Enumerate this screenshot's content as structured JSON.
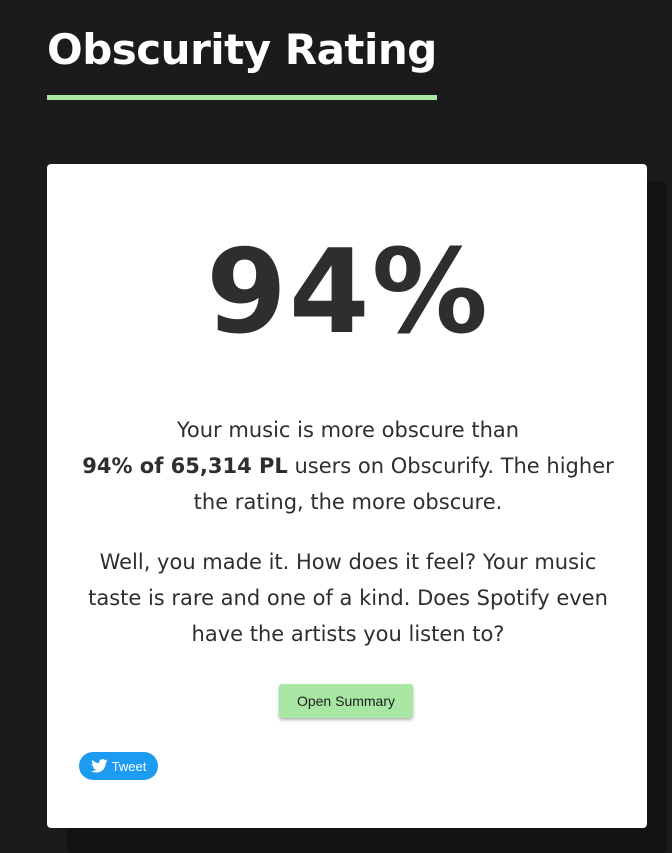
{
  "header": {
    "title": "Obscurity Rating"
  },
  "card": {
    "rating": "94%",
    "summary": {
      "lead": "Your music is more obscure than",
      "bold": "94% of 65,314 PL",
      "rest": " users on Obscurify. The higher the rating, the more obscure."
    },
    "message": "Well, you made it. How does it feel? Your music taste is rare and one of a kind. Does Spotify even have the artists you listen to?",
    "summary_button_label": "Open Summary",
    "tweet_button_label": "Tweet",
    "tweet_icon": "twitter-bird-icon"
  },
  "colors": {
    "background": "#1b1b1b",
    "accent": "#a8e6a3",
    "card": "#ffffff",
    "text": "#2e2e2e",
    "twitter": "#1d9bf0"
  }
}
